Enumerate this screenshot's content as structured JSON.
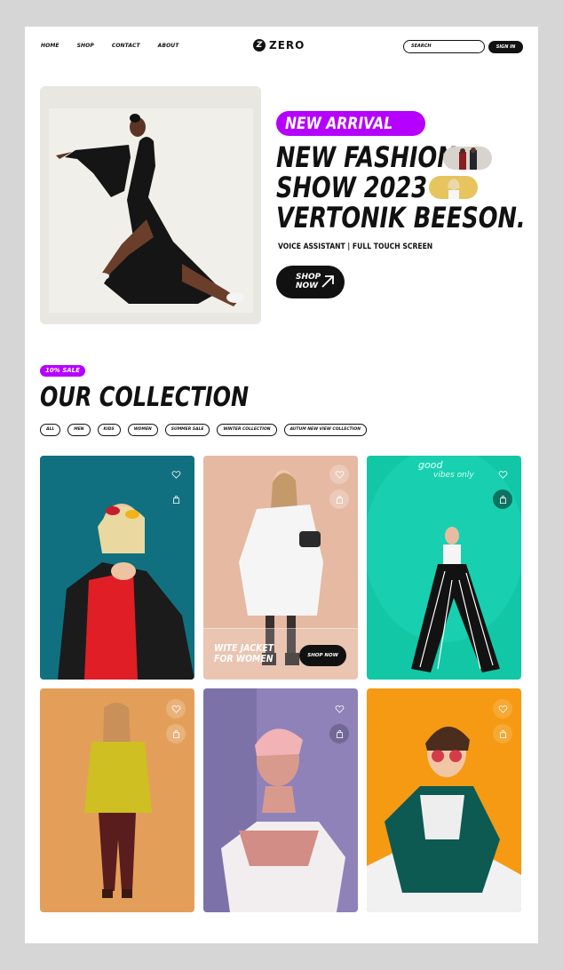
{
  "nav": {
    "links": [
      "HOME",
      "SHOP",
      "CONTACT",
      "ABOUT"
    ],
    "logo": "ZERO",
    "logo_mark": "Z",
    "search_placeholder": "SEARCH",
    "signin": "SIGN IN"
  },
  "hero": {
    "badge": "NEW ARRIVAL",
    "title_lines": [
      "NEW FASHION",
      "SHOW 2023",
      "VERTONIK BEESON."
    ],
    "subtitle": "VOICE ASSISTANT | FULL TOUCH SCREEN",
    "cta": [
      "SHOP",
      "NOW"
    ]
  },
  "collection": {
    "sale_badge": "10% SALE",
    "title": "OUR COLLECTION",
    "filters": [
      "ALL",
      "MEN",
      "KIDS",
      "WOMEN",
      "SUMMER SALE",
      "WINTER COLLECTION",
      "AUTUM NEW VIEW COLLECTION"
    ],
    "featured": {
      "name_lines": [
        "WITE JACKET",
        "FOR WOMEN"
      ],
      "button": "SHOP NOW"
    },
    "neon_sign": [
      "good",
      "vibes only"
    ]
  },
  "icons": [
    "heart-icon",
    "bag-icon",
    "arrow-up-right-icon"
  ],
  "colors": {
    "accent": "#b600ff",
    "dark": "#111111",
    "card_bg": [
      "#10707f",
      "#e6b9a2",
      "#11c7a6",
      "#e39f59",
      "#8e82b8",
      "#f59a12"
    ]
  }
}
